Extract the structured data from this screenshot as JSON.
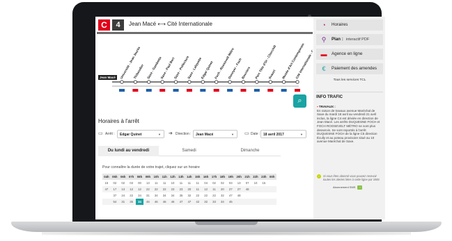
{
  "header": {
    "line_letter": "C",
    "line_number": "4",
    "route": "Jean Macé ⟷ Cité Internationale"
  },
  "map": {
    "current_stop": "Jean Macé",
    "stops": [
      "Université - Jean Jaurès",
      "Thiboudier",
      "Saxe - Gambetta",
      "Saxe - Paul Bert",
      "Saxe - Préfecture",
      "Saxe - Lafayette",
      "Edgar Quinet",
      "Foch - Roosevelt Métro",
      "Dunoyer - Foch",
      "Bouviers",
      "Parc Tête d'Or - Churchill",
      "Ilvauxt",
      "Musée d'Art Contemporain",
      "Cité Internationale - Centre de Congrès"
    ],
    "final_stop_label": "Cité Internationale - Centre de Congrès"
  },
  "schedule": {
    "title": "Horaires à l'arrêt",
    "stop_label": "Arrêt :",
    "stop_value": "Edgar Quinet",
    "direction_label": "Direction :",
    "direction_value": "Jean Macé",
    "date_label": "Date :",
    "date_value": "18 avril 2017",
    "tabs": [
      "Du lundi au vendredi",
      "Samedi",
      "Dimanche"
    ],
    "help_text": "Pour connaître la durée de votre trajet, cliquez sur un horaire",
    "hours": [
      "04h",
      "05h",
      "06h",
      "07h",
      "08h",
      "09h",
      "10h",
      "11h",
      "12h",
      "13h",
      "14h",
      "15h",
      "16h",
      "17h",
      "18h",
      "19h",
      "20h",
      "21h",
      "22h",
      "23h",
      "00h"
    ],
    "rows": [
      [
        "15",
        "02",
        "02",
        "03",
        "00",
        "13",
        "11",
        "11",
        "10",
        "11",
        "11",
        "11",
        "04",
        "02",
        "02",
        "03",
        "13",
        "07",
        "10",
        "15",
        ""
      ],
      [
        "47",
        "17",
        "13",
        "12",
        "12",
        "22",
        "22",
        "22",
        "23",
        "23",
        "20",
        "11",
        "12",
        "11",
        "20",
        "27",
        "27",
        "48",
        "",
        "",
        ""
      ],
      [
        "",
        "37",
        "24",
        "22",
        "34",
        "31",
        "34",
        "34",
        "34",
        "35",
        "32",
        "22",
        "22",
        "22",
        "32",
        "47",
        "48",
        "",
        "",
        "",
        ""
      ],
      [
        "",
        "54",
        "31",
        "35",
        "34",
        "46",
        "46",
        "46",
        "46",
        "47",
        "47",
        "42",
        "32",
        "33",
        "34",
        "45",
        "",
        "",
        "",
        "",
        ""
      ]
    ],
    "highlighted": "31"
  },
  "sidebar": {
    "items": [
      {
        "label": "Horaires",
        "icon": "clock-icon",
        "extra": ""
      },
      {
        "label": "Plan :",
        "icon": "map-pin-icon",
        "extra": "interactif   PDF"
      },
      {
        "label": "Agence en ligne",
        "icon": "card-icon",
        "extra": ""
      },
      {
        "label": "Paiement des amendes",
        "icon": "euro-icon",
        "extra": ""
      }
    ],
    "all_services": "Tous les services TCL",
    "info_title": "INFO TRAFIC",
    "info_heading": "TRAVAUX :",
    "info_text": "En raison de travaux avenue Maréchal de Saxe du mardi 18 avril au vendredi 21 avril inclus, la ligne C4 est déviée en direction de Jean Macé. Les arrêts DUQUESNE FOCH et FOCH ROOSEVELT MÉTRO ne sont plus desservis. Se sont reportés à l'arrêt DUQUESNE FOCH de la ligne C5 direction Écully et au poteau provisoire situé au 10 avenue Maréchal de Saxe.",
    "alert_note": "Si vous êtes abonné vous pouvez recevoir toutes les alertes liées à cette ligne par SMS",
    "subscribe_label": "Abonnement SMS",
    "subscribe_go": "›"
  },
  "colors": {
    "brand_red": "#e2001a",
    "accent_teal": "#1aa3a3",
    "sidebar_bg": "#f1f1f1"
  }
}
